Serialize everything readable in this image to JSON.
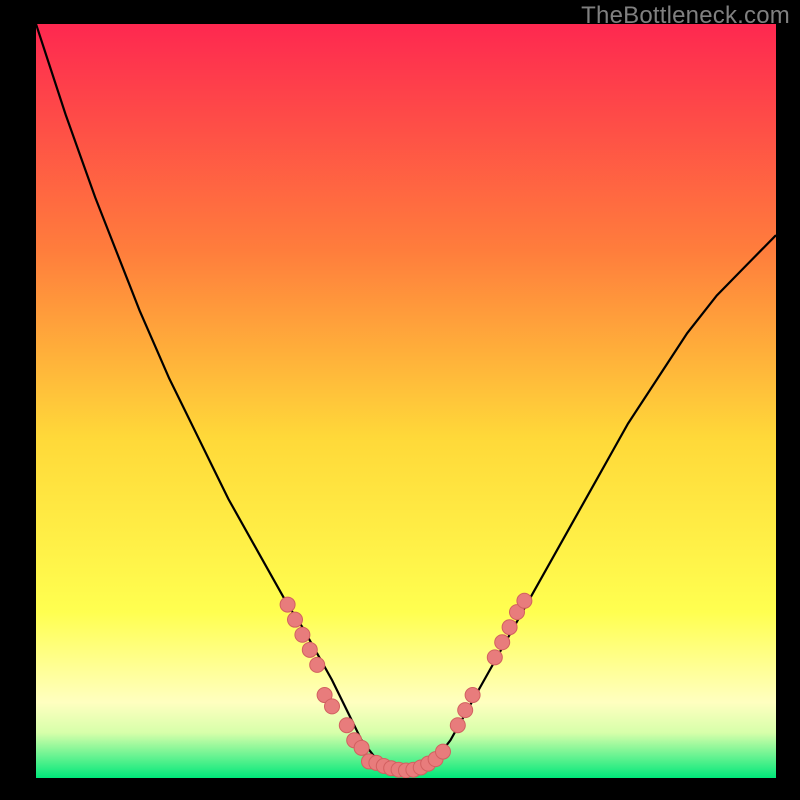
{
  "attribution": "TheBottleneck.com",
  "colors": {
    "frame": "#000000",
    "gradient_top": "#fe2850",
    "gradient_mid_upper": "#ff7d3c",
    "gradient_mid": "#ffd939",
    "gradient_mid_lower": "#ffff50",
    "gradient_pale": "#ffffc0",
    "gradient_bottom_start": "#d7ffaa",
    "gradient_bottom_end": "#00e87a",
    "curve": "#000000",
    "marker_fill": "#e87c7c",
    "marker_stroke": "#d26060"
  },
  "chart_data": {
    "type": "line",
    "title": "",
    "xlabel": "",
    "ylabel": "",
    "xlim": [
      0,
      100
    ],
    "ylim": [
      0,
      100
    ],
    "series": [
      {
        "name": "bottleneck-curve",
        "x": [
          0,
          2,
          4,
          6,
          8,
          10,
          12,
          14,
          16,
          18,
          20,
          22,
          24,
          26,
          28,
          30,
          32,
          34,
          36,
          38,
          40,
          42,
          44,
          46,
          48,
          50,
          52,
          54,
          56,
          58,
          60,
          62,
          64,
          66,
          68,
          70,
          72,
          74,
          76,
          78,
          80,
          82,
          84,
          86,
          88,
          90,
          92,
          94,
          96,
          98,
          100
        ],
        "y": [
          100,
          94,
          88,
          82.5,
          77,
          72,
          67,
          62,
          57.5,
          53,
          49,
          45,
          41,
          37,
          33.5,
          30,
          26.5,
          23,
          20,
          16.5,
          13,
          9,
          5,
          2.5,
          1.3,
          1.0,
          1.3,
          2.5,
          5,
          8.5,
          12,
          15.5,
          19,
          22.5,
          26,
          29.5,
          33,
          36.5,
          40,
          43.5,
          47,
          50,
          53,
          56,
          59,
          61.5,
          64,
          66,
          68,
          70,
          72
        ]
      }
    ],
    "markers": [
      {
        "x": 34,
        "y": 23
      },
      {
        "x": 35,
        "y": 21
      },
      {
        "x": 36,
        "y": 19
      },
      {
        "x": 37,
        "y": 17
      },
      {
        "x": 38,
        "y": 15
      },
      {
        "x": 39,
        "y": 11
      },
      {
        "x": 40,
        "y": 9.5
      },
      {
        "x": 42,
        "y": 7
      },
      {
        "x": 43,
        "y": 5
      },
      {
        "x": 44,
        "y": 4
      },
      {
        "x": 45,
        "y": 2.2
      },
      {
        "x": 46,
        "y": 2.0
      },
      {
        "x": 47,
        "y": 1.6
      },
      {
        "x": 48,
        "y": 1.3
      },
      {
        "x": 49,
        "y": 1.1
      },
      {
        "x": 50,
        "y": 1.0
      },
      {
        "x": 51,
        "y": 1.1
      },
      {
        "x": 52,
        "y": 1.4
      },
      {
        "x": 53,
        "y": 1.9
      },
      {
        "x": 54,
        "y": 2.5
      },
      {
        "x": 55,
        "y": 3.5
      },
      {
        "x": 57,
        "y": 7
      },
      {
        "x": 58,
        "y": 9
      },
      {
        "x": 59,
        "y": 11
      },
      {
        "x": 62,
        "y": 16
      },
      {
        "x": 63,
        "y": 18
      },
      {
        "x": 64,
        "y": 20
      },
      {
        "x": 65,
        "y": 22
      },
      {
        "x": 66,
        "y": 23.5
      }
    ]
  }
}
